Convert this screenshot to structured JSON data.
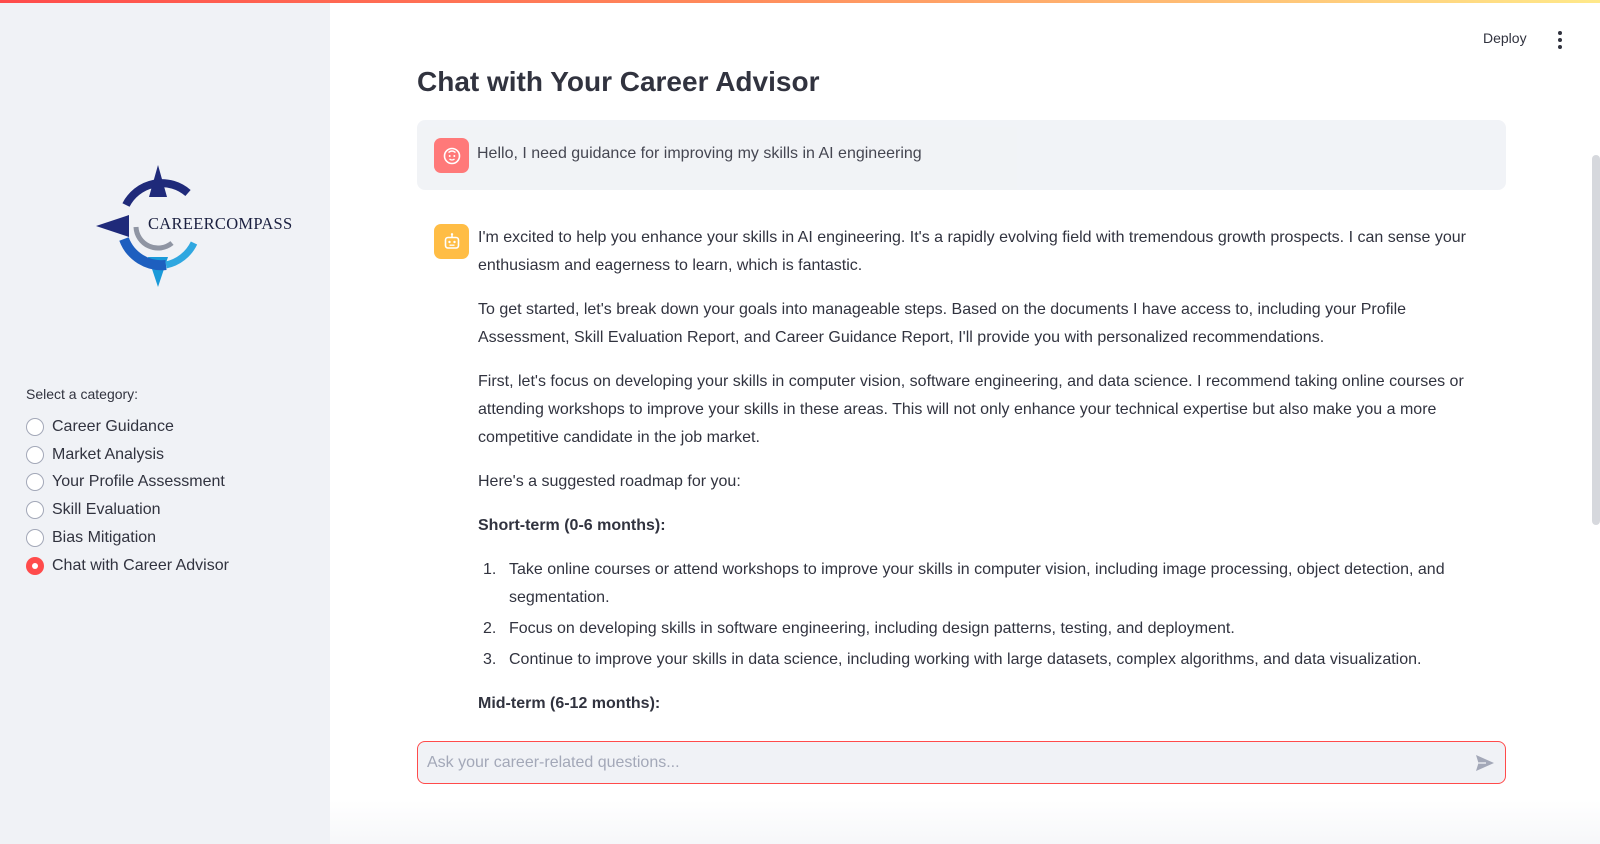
{
  "app": {
    "deploy_label": "Deploy",
    "menu_icon": "kebab-menu-icon"
  },
  "sidebar": {
    "logo_text": "CAREERCOMPASS",
    "category_label": "Select a category:",
    "items": [
      {
        "label": "Career Guidance",
        "selected": false
      },
      {
        "label": "Market Analysis",
        "selected": false
      },
      {
        "label": "Your Profile Assessment",
        "selected": false
      },
      {
        "label": "Skill Evaluation",
        "selected": false
      },
      {
        "label": "Bias Mitigation",
        "selected": false
      },
      {
        "label": "Chat with Career Advisor",
        "selected": true
      }
    ]
  },
  "main": {
    "title": "Chat with Your Career Advisor",
    "user_message": "Hello, I need guidance for improving my skills in AI engineering",
    "assistant": {
      "p1": "I'm excited to help you enhance your skills in AI engineering. It's a rapidly evolving field with tremendous growth prospects. I can sense your enthusiasm and eagerness to learn, which is fantastic.",
      "p2": "To get started, let's break down your goals into manageable steps. Based on the documents I have access to, including your Profile Assessment, Skill Evaluation Report, and Career Guidance Report, I'll provide you with personalized recommendations.",
      "p3": "First, let's focus on developing your skills in computer vision, software engineering, and data science. I recommend taking online courses or attending workshops to improve your skills in these areas. This will not only enhance your technical expertise but also make you a more competitive candidate in the job market.",
      "p4": "Here's a suggested roadmap for you:",
      "short_term_heading": "Short-term (0-6 months):",
      "short_term": [
        {
          "num": "1.",
          "text": "Take online courses or attend workshops to improve your skills in computer vision, including image processing, object detection, and segmentation."
        },
        {
          "num": "2.",
          "text": "Focus on developing skills in software engineering, including design patterns, testing, and deployment."
        },
        {
          "num": "3.",
          "text": "Continue to improve your skills in data science, including working with large datasets, complex algorithms, and data visualization."
        }
      ],
      "mid_term_heading": "Mid-term (6-12 months):"
    }
  },
  "chat_input": {
    "placeholder": "Ask your career-related questions...",
    "value": ""
  },
  "colors": {
    "accent": "#ff4b4b",
    "sidebar_bg": "#f0f2f6",
    "user_avatar": "#ff6b6b",
    "bot_avatar": "#ffbd45"
  }
}
